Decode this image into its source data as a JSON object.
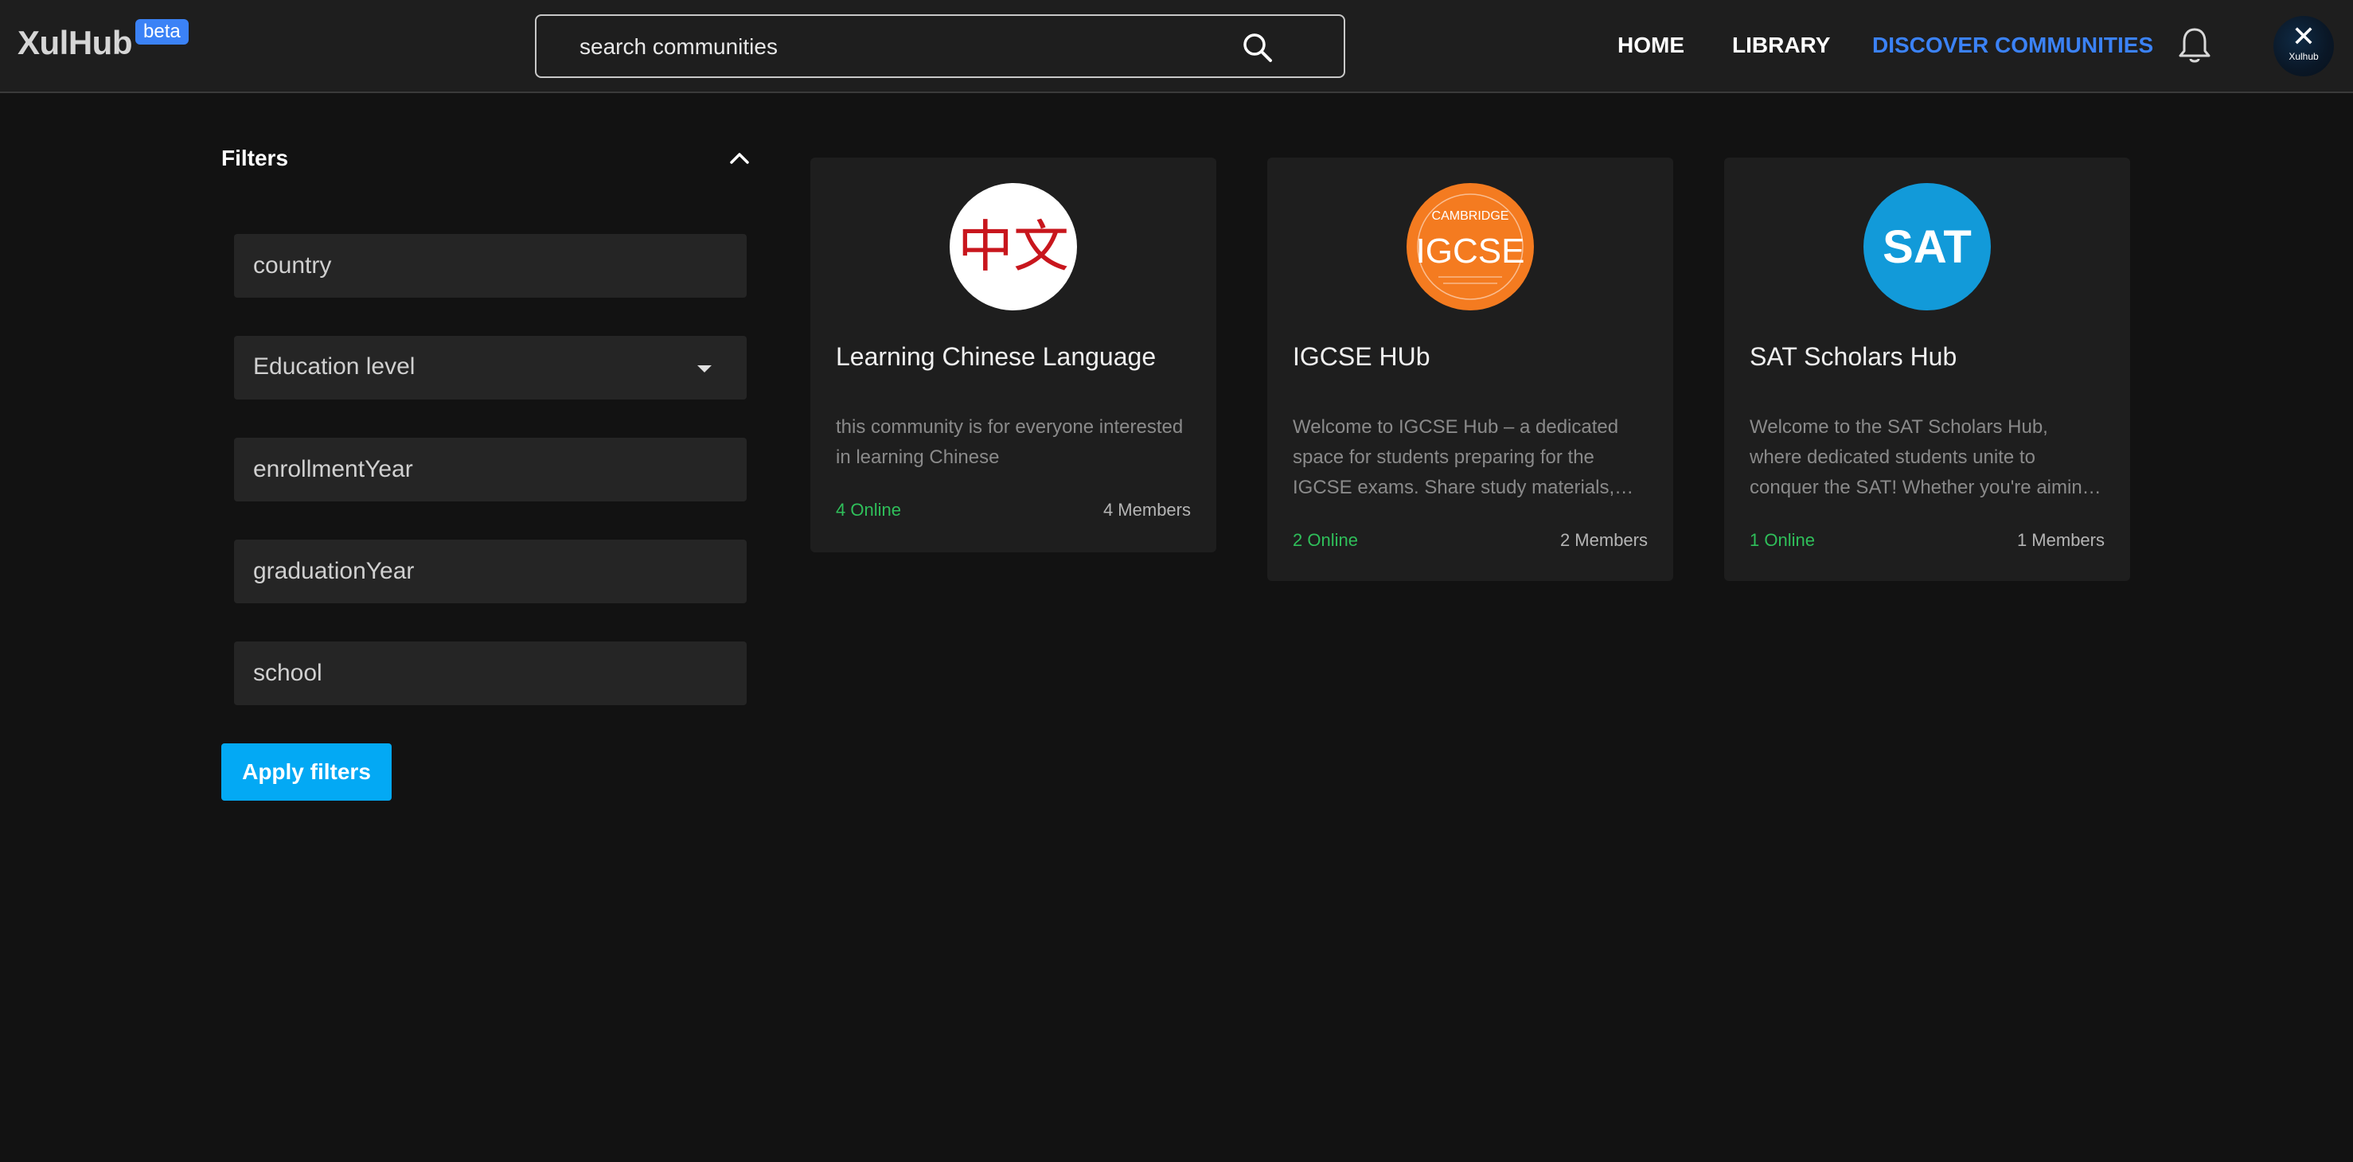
{
  "header": {
    "logo": "XulHub",
    "badge": "beta",
    "search_placeholder": "search communities",
    "nav": [
      {
        "label": "HOME",
        "active": false
      },
      {
        "label": "LIBRARY",
        "active": false
      },
      {
        "label": "DISCOVER COMMUNITIES",
        "active": true
      }
    ],
    "avatar_text": "Xulhub"
  },
  "filters": {
    "title": "Filters",
    "fields": {
      "country": "country",
      "education_level": "Education level",
      "enrollment_year": "enrollmentYear",
      "graduation_year": "graduationYear",
      "school": "school"
    },
    "apply_label": "Apply filters"
  },
  "communities": [
    {
      "name": "Learning Chinese Language",
      "image_text": "中文",
      "description": "this community is for everyone interested in learning Chinese",
      "online": "4 Online",
      "members": "4 Members"
    },
    {
      "name": "IGCSE HUb",
      "image_text": "IGCSE",
      "image_top_text": "CAMBRIDGE",
      "description": "Welcome to IGCSE Hub – a dedicated space for students preparing for the IGCSE exams. Share study materials, ask questions and connect with fellow students.",
      "online": "2 Online",
      "members": "2 Members"
    },
    {
      "name": "SAT Scholars Hub",
      "image_text": "SAT",
      "description": "Welcome to the SAT Scholars Hub, where dedicated students unite to conquer the SAT! Whether you're aiming for a top score, join us.",
      "online": "1 Online",
      "members": "1 Members"
    }
  ],
  "colors": {
    "accent": "#3b82f6",
    "button": "#03a9f4",
    "online": "#2fbf5a",
    "igcse": "#f47b20",
    "sat": "#129ad9",
    "chinese_red": "#c8161d"
  }
}
